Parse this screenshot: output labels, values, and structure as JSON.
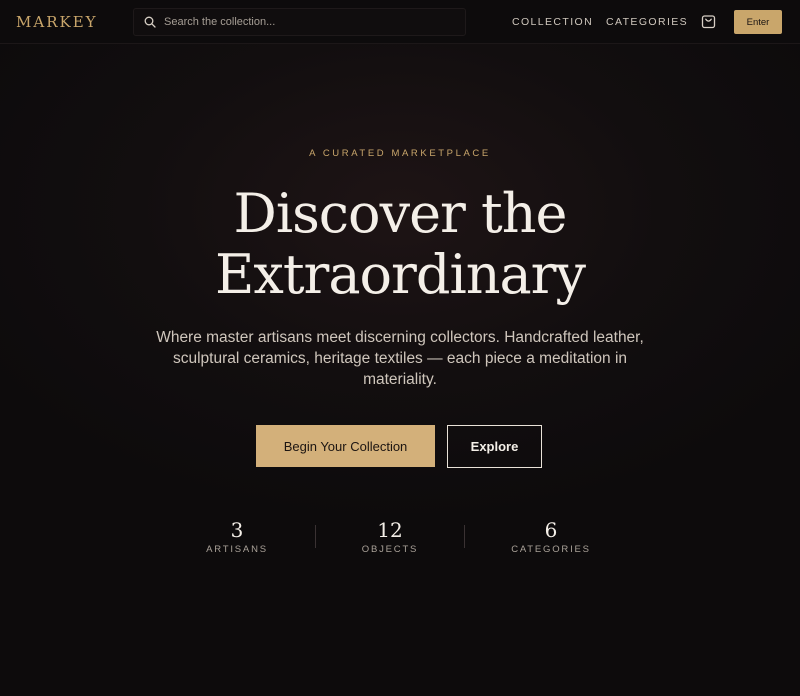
{
  "brand": {
    "logo": "MARKEY"
  },
  "search": {
    "placeholder": "Search the collection..."
  },
  "nav": {
    "links": [
      {
        "label": "COLLECTION"
      },
      {
        "label": "CATEGORIES"
      }
    ],
    "cart_icon": "cart-icon",
    "enter_label": "Enter"
  },
  "hero": {
    "eyebrow": "A CURATED MARKETPLACE",
    "headline_line1": "Discover the",
    "headline_line2": "Extraordinary",
    "subtext": "Where master artisans meet discerning collectors. Handcrafted leather, sculptural ceramics, heritage textiles — each piece a meditation in materiality.",
    "primary_cta": "Begin Your Collection",
    "secondary_cta": "Explore"
  },
  "stats": [
    {
      "value": "3",
      "label": "ARTISANS"
    },
    {
      "value": "12",
      "label": "OBJECTS"
    },
    {
      "value": "6",
      "label": "CATEGORIES"
    }
  ],
  "colors": {
    "background": "#0f0c0d",
    "accent_gold": "#c9a66b",
    "text_primary": "#f4efe8",
    "text_muted": "#a9a198"
  }
}
